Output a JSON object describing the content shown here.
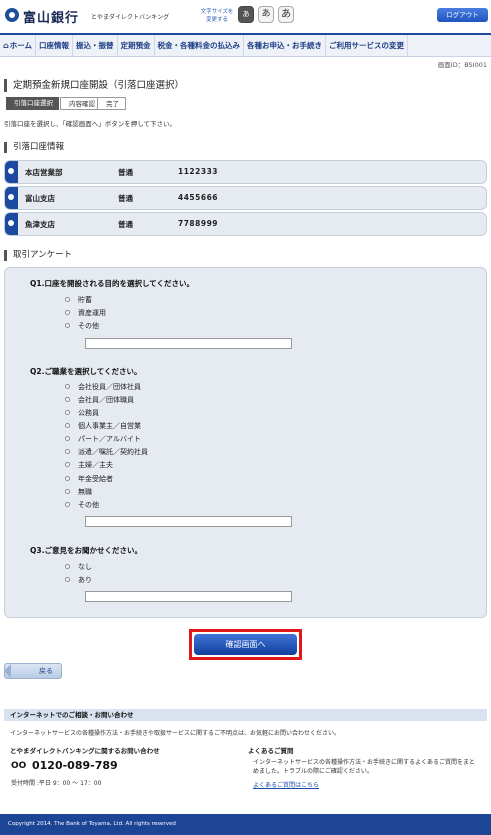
{
  "header": {
    "bank_name": "富山銀行",
    "service_name": "とやまダイレクトバンキング",
    "font_size_label": "文字サイズを\n変更する",
    "font_size_buttons": [
      "あ",
      "あ",
      "あ"
    ],
    "logout_label": "ログアウト"
  },
  "nav": {
    "items": [
      "ホーム",
      "口座情報",
      "振込・振替",
      "定期預金",
      "税金・各種料金の払込み",
      "各種お申込・お手続き",
      "ご利用サービスの変更"
    ]
  },
  "screen_id": "画面ID：BSI001",
  "page_title": "定期預金新規口座開設（引落口座選択）",
  "steps": [
    "引落口座選択",
    "内容確認",
    "完了"
  ],
  "instruction": "引落口座を選択し、「確認画面へ」ボタンを押して下さい。",
  "account_section": {
    "title": "引落口座情報",
    "accounts": [
      {
        "branch": "本店営業部",
        "type": "普通",
        "number": "1122333",
        "selected": true
      },
      {
        "branch": "富山支店",
        "type": "普通",
        "number": "4455666",
        "selected": false
      },
      {
        "branch": "魚津支店",
        "type": "普通",
        "number": "7788999",
        "selected": false
      }
    ]
  },
  "survey": {
    "title": "取引アンケート",
    "q1": {
      "label": "Q1.口座を開設される目的を選択してください。",
      "options": [
        "貯蓄",
        "資産運用",
        "その他"
      ]
    },
    "q2": {
      "label": "Q2.ご職業を選択してください。",
      "options": [
        "会社役員／団体社員",
        "会社員／団体職員",
        "公務員",
        "個人事業主／自営業",
        "パート／アルバイト",
        "派遣／嘱託／契約社員",
        "主婦／主夫",
        "年金受給者",
        "無職",
        "その他"
      ]
    },
    "q3": {
      "label": "Q3.ご意見をお聞かせください。",
      "options": [
        "なし",
        "あり"
      ]
    }
  },
  "buttons": {
    "confirm": "確認画面へ",
    "back": "戻る"
  },
  "contact": {
    "bar_title": "インターネットでのご相談・お問い合わせ",
    "description": "インターネットサービスの各種操作方法・お手続きや取扱サービスに関するご不明点は、お気軽にお問い合わせください。",
    "phone_heading": "とやまダイレクトバンキングに関するお問い合わせ",
    "phone_icon": "OO",
    "phone": "0120-089-789",
    "hours": "受付時間 :平日 9：00 〜 17：00",
    "faq_heading": "よくあるご質問",
    "faq_description": "インターネットサービスの各種操作方法・お手続きに関するよくあるご質問をまとめました。トラブルの際にご確認ください。",
    "faq_link": "よくあるご質問はこちら"
  },
  "footer": "Copyright 2014. The Bank of Toyama, Ltd. All rights reserved"
}
